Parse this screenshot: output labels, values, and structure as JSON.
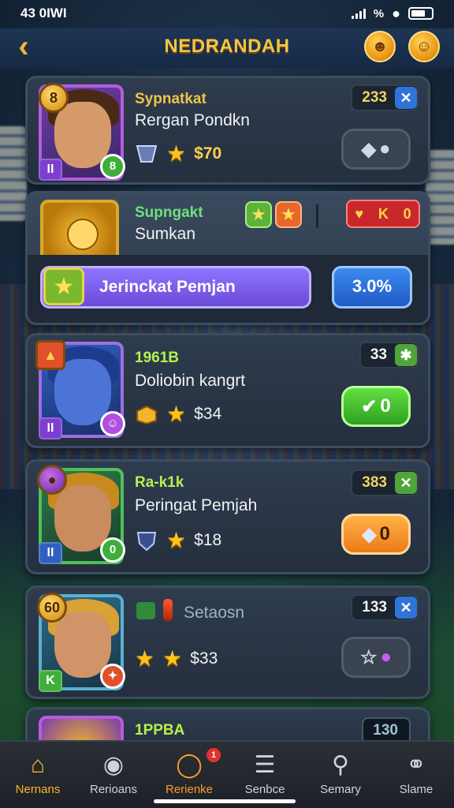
{
  "status_bar": {
    "time": "43 0IWI",
    "battery_text": "%",
    "battery_level": 0.7
  },
  "header": {
    "title": "NEDRANDAH"
  },
  "cards": [
    {
      "title": "Sypnatkat",
      "subtitle": "Rergan Pondkn",
      "price": "$70",
      "count": "233",
      "badge_tl": "8",
      "badge_bl": "II",
      "badge_br": "8"
    },
    {
      "title": "Supngakt",
      "subtitle": "Sumkan",
      "progress_label": "Jerinckat Pemjan",
      "percent_label": "3.0%",
      "right_value": "K",
      "right_value2": "0"
    },
    {
      "title": "1961B",
      "subtitle": "Doliobin kangrt",
      "price": "$34",
      "count": "33",
      "badge_bl": "II",
      "btn_label": "0"
    },
    {
      "title": "Ra-k1k",
      "subtitle": "Peringat Pemjah",
      "price": "$18",
      "count": "383",
      "badge_bl": "II",
      "badge_br": "0",
      "btn_label": "0"
    },
    {
      "title": "Setaosn",
      "price": "$33",
      "count": "133",
      "badge_tl": "60",
      "badge_bl": "K"
    },
    {
      "title": "1PPBA",
      "count": "130"
    }
  ],
  "bottom_nav": [
    {
      "label": "Nernans"
    },
    {
      "label": "Rerioans"
    },
    {
      "label": "Rerienke",
      "badge": "1"
    },
    {
      "label": "Senbce"
    },
    {
      "label": "Semary"
    },
    {
      "label": "Slame"
    }
  ],
  "colors": {
    "accent_gold": "#f5c542",
    "card_bg": "#2e3c4e",
    "nav_active": "#ffb423",
    "green_button": "#46c62a",
    "orange_button": "#ff9a2e",
    "purple_bar": "#7b5ae8"
  }
}
